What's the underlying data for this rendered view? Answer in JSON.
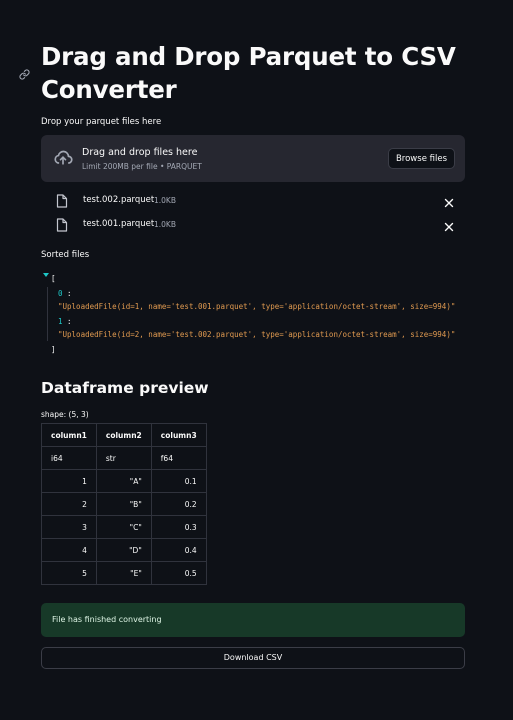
{
  "page": {
    "title": "Drag and Drop Parquet to CSV Converter"
  },
  "uploader": {
    "label": "Drop your parquet files here",
    "drop_text": "Drag and drop files here",
    "limit_text": "Limit 200MB per file • PARQUET",
    "browse_label": "Browse files",
    "files": [
      {
        "name": "test.002.parquet",
        "size": "1.0KB"
      },
      {
        "name": "test.001.parquet",
        "size": "1.0KB"
      }
    ]
  },
  "sorted": {
    "label": "Sorted files",
    "open": "[",
    "close": "]",
    "items": [
      {
        "key": "0",
        "value": "\"UploadedFile(id=1, name='test.001.parquet', type='application/octet-stream', size=994)\""
      },
      {
        "key": "1",
        "value": "\"UploadedFile(id=2, name='test.002.parquet', type='application/octet-stream', size=994)\""
      }
    ]
  },
  "preview": {
    "heading": "Dataframe preview",
    "shape": "shape: (5, 3)",
    "columns": [
      "column1",
      "column2",
      "column3"
    ],
    "dtypes": [
      "i64",
      "str",
      "f64"
    ],
    "rows": [
      [
        "1",
        "\"A\"",
        "0.1"
      ],
      [
        "2",
        "\"B\"",
        "0.2"
      ],
      [
        "3",
        "\"C\"",
        "0.3"
      ],
      [
        "4",
        "\"D\"",
        "0.4"
      ],
      [
        "5",
        "\"E\"",
        "0.5"
      ]
    ]
  },
  "status": {
    "message": "File has finished converting"
  },
  "download": {
    "label": "Download CSV"
  },
  "icons": {
    "anchor": "link-icon",
    "upload": "cloud-upload-icon",
    "file": "file-icon",
    "remove": "close-icon"
  },
  "colors": {
    "background": "#0e1117",
    "panel": "#262730",
    "json_key": "#1ec8c8",
    "json_string": "#e09a50",
    "success_bg": "#173928"
  }
}
